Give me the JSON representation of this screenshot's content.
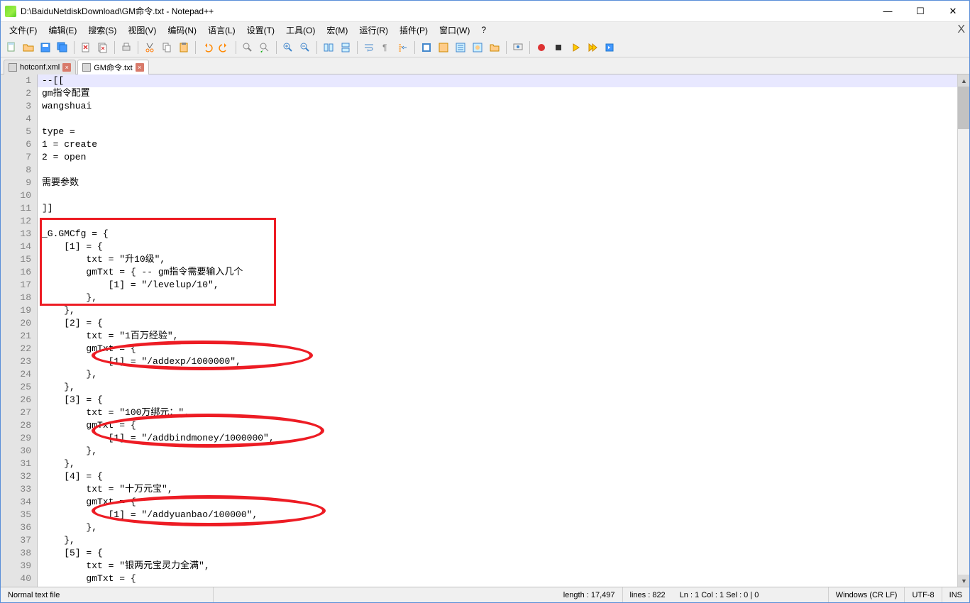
{
  "window": {
    "title": "D:\\BaiduNetdiskDownload\\GM命令.txt - Notepad++",
    "min": "—",
    "max": "☐",
    "close": "✕"
  },
  "menu": {
    "items": [
      "文件(F)",
      "编辑(E)",
      "搜索(S)",
      "视图(V)",
      "编码(N)",
      "语言(L)",
      "设置(T)",
      "工具(O)",
      "宏(M)",
      "运行(R)",
      "插件(P)",
      "窗口(W)",
      "?"
    ]
  },
  "tabs": {
    "items": [
      {
        "label": "hotconf.xml",
        "active": false
      },
      {
        "label": "GM命令.txt",
        "active": true
      }
    ]
  },
  "code": {
    "lines": [
      "--[[",
      "gm指令配置",
      "wangshuai",
      "",
      "type =",
      "1 = create",
      "2 = open",
      "",
      "需要参数",
      "",
      "]]",
      "",
      "_G.GMCfg = {",
      "    [1] = {",
      "        txt = \"升10级\",",
      "        gmTxt = { -- gm指令需要输入几个",
      "            [1] = \"/levelup/10\",",
      "        },",
      "    },",
      "    [2] = {",
      "        txt = \"1百万经验\",",
      "        gmTxt = {",
      "            [1] = \"/addexp/1000000\",",
      "        },",
      "    },",
      "    [3] = {",
      "        txt = \"100万绑元：\",",
      "        gmTxt = {",
      "            [1] = \"/addbindmoney/1000000\",",
      "        },",
      "    },",
      "    [4] = {",
      "        txt = \"十万元宝\",",
      "        gmTxt = {",
      "            [1] = \"/addyuanbao/100000\",",
      "        },",
      "    },",
      "    [5] = {",
      "        txt = \"银两元宝灵力全满\",",
      "        gmTxt = {"
    ]
  },
  "status": {
    "filetype": "Normal text file",
    "length": "length : 17,497",
    "lines": "lines : 822",
    "pos": "Ln : 1    Col : 1    Sel : 0 | 0",
    "eol": "Windows (CR LF)",
    "encoding": "UTF-8",
    "ins": "INS"
  }
}
